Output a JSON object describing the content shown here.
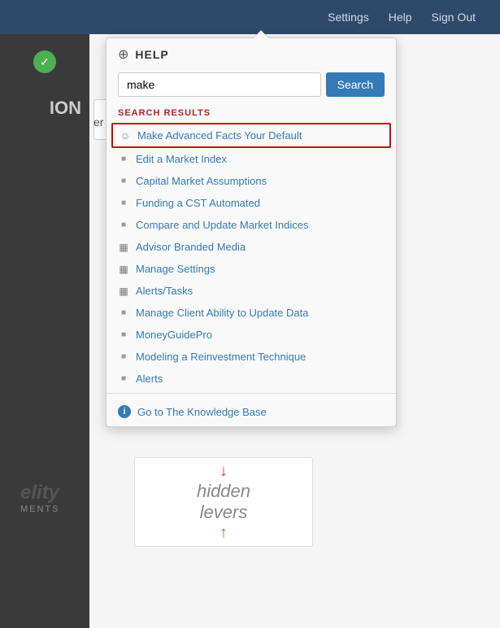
{
  "topnav": {
    "settings_label": "Settings",
    "help_label": "Help",
    "signout_label": "Sign Out"
  },
  "sidebar": {
    "partial_text": "ION"
  },
  "main": {
    "er_capital_label": "er Capital"
  },
  "help_popup": {
    "title": "HELP",
    "globe_icon": "⊕",
    "search_input_value": "make",
    "search_button_label": "Search",
    "search_results_label": "SEARCH RESULTS",
    "results": [
      {
        "id": 1,
        "label": "Make Advanced Facts Your Default",
        "icon_type": "person",
        "highlighted": true
      },
      {
        "id": 2,
        "label": "Edit a Market Index",
        "icon_type": "doc",
        "highlighted": false
      },
      {
        "id": 3,
        "label": "Capital Market Assumptions",
        "icon_type": "doc",
        "highlighted": false
      },
      {
        "id": 4,
        "label": "Funding a CST Automated",
        "icon_type": "doc",
        "highlighted": false
      },
      {
        "id": 5,
        "label": "Compare and Update Market Indices",
        "icon_type": "doc",
        "highlighted": false
      },
      {
        "id": 6,
        "label": "Advisor Branded Media",
        "icon_type": "grid",
        "highlighted": false
      },
      {
        "id": 7,
        "label": "Manage Settings",
        "icon_type": "grid",
        "highlighted": false
      },
      {
        "id": 8,
        "label": "Alerts/Tasks",
        "icon_type": "grid",
        "highlighted": false
      },
      {
        "id": 9,
        "label": "Manage Client Ability to Update Data",
        "icon_type": "doc",
        "highlighted": false
      },
      {
        "id": 10,
        "label": "MoneyGuidePro",
        "icon_type": "doc",
        "highlighted": false
      },
      {
        "id": 11,
        "label": "Modeling a Reinvestment Technique",
        "icon_type": "doc",
        "highlighted": false
      },
      {
        "id": 12,
        "label": "Alerts",
        "icon_type": "doc",
        "highlighted": false
      }
    ],
    "knowledge_base_label": "Go to The Knowledge Base",
    "info_icon": "i"
  },
  "hidden_levers": {
    "line1": "hidden",
    "line2": "levers"
  },
  "fidelity": {
    "name": "elity",
    "sub": "MENTS"
  }
}
